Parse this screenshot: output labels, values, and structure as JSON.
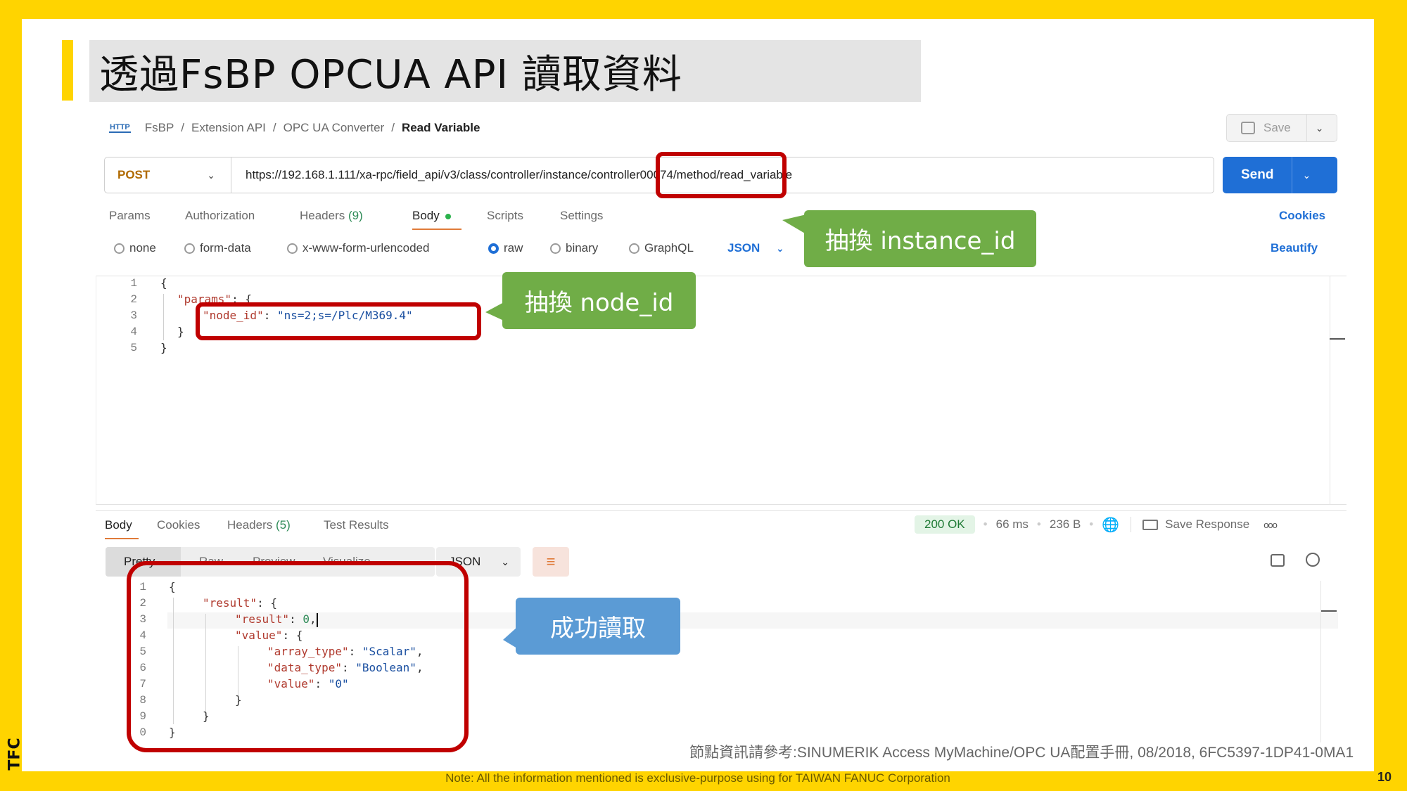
{
  "slide": {
    "title": "透過FsBP OPCUA API 讀取資料",
    "page_number": "10",
    "logo": "TFC",
    "footer_note": "Note: All the information mentioned is exclusive-purpose using for TAIWAN FANUC Corporation",
    "reference": "節點資訊請參考:SINUMERIK Access MyMachine/OPC UA配置手冊, 08/2018, 6FC5397-1DP41-0MA1"
  },
  "breadcrumb": {
    "icon_text": "HTTP",
    "items": [
      "FsBP",
      "Extension API",
      "OPC UA Converter"
    ],
    "separator": "/",
    "current": "Read Variable"
  },
  "toolbar": {
    "save_label": "Save"
  },
  "request": {
    "method": "POST",
    "url": "https://192.168.1.111/xa-rpc/field_api/v3/class/controller/instance/controller00074/method/read_variable",
    "send_label": "Send"
  },
  "request_tabs": {
    "items": [
      "Params",
      "Authorization",
      "Headers",
      "Body",
      "Scripts",
      "Settings"
    ],
    "headers_count": "(9)",
    "cookies_label": "Cookies"
  },
  "body_types": {
    "options": [
      "none",
      "form-data",
      "x-www-form-urlencoded",
      "raw",
      "binary",
      "GraphQL"
    ],
    "selected": "raw",
    "format": "JSON",
    "beautify_label": "Beautify"
  },
  "request_body": {
    "line_numbers": [
      "1",
      "2",
      "3",
      "4",
      "5"
    ],
    "line1": "{",
    "params_key": "\"params\"",
    "colon_brace": ": {",
    "node_key": "\"node_id\"",
    "colon": ": ",
    "node_value": "\"ns=2;s=/Plc/M369.4\"",
    "close_inner": "}",
    "close_outer": "}"
  },
  "response_tabs": {
    "items": [
      "Body",
      "Cookies",
      "Headers",
      "Test Results"
    ],
    "headers_count": "(5)",
    "status": "200 OK",
    "time": "66 ms",
    "size": "236 B",
    "save_response_label": "Save Response",
    "more_label": "ooo"
  },
  "response_view": {
    "modes": [
      "Pretty",
      "Raw",
      "Preview",
      "Visualize"
    ],
    "format": "JSON"
  },
  "response_body": {
    "line_numbers": [
      "1",
      "2",
      "3",
      "4",
      "5",
      "6",
      "7",
      "8",
      "9",
      "0"
    ],
    "l1": "{",
    "result_key": "\"result\"",
    "l2_tail": ": {",
    "inner_result_key": "\"result\"",
    "inner_result_val": "0",
    "value_key": "\"value\"",
    "l4_tail": ": {",
    "array_type_key": "\"array_type\"",
    "array_type_val": "\"Scalar\"",
    "data_type_key": "\"data_type\"",
    "data_type_val": "\"Boolean\"",
    "value_inner_key": "\"value\"",
    "value_inner_val": "\"0\"",
    "l8": "}",
    "l9": "}",
    "l10": "}"
  },
  "callouts": {
    "instance": "抽換 instance_id",
    "node": "抽換 node_id",
    "success": "成功讀取"
  }
}
